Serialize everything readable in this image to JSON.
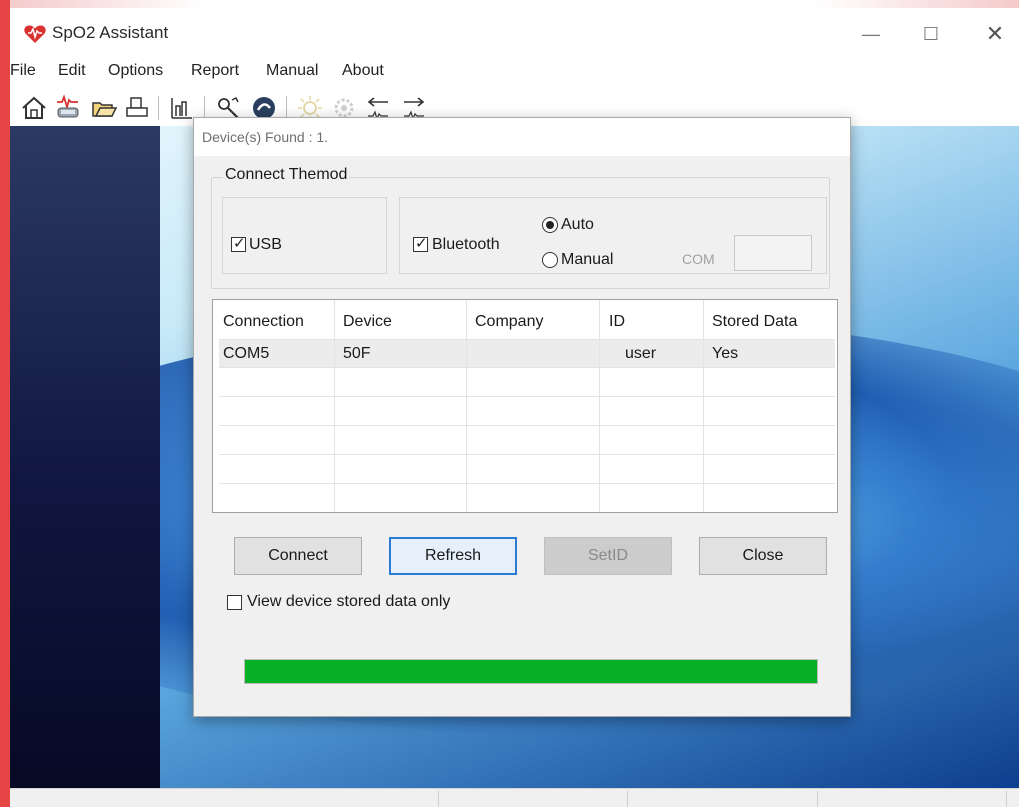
{
  "app": {
    "title": "SpO2 Assistant"
  },
  "window_controls": {
    "minimize": "—",
    "maximize": "☐",
    "close": "✕"
  },
  "menu": [
    "File",
    "Edit",
    "Options",
    "Report",
    "Manual",
    "About"
  ],
  "toolbar": {
    "icons": [
      "home-icon",
      "device-icon",
      "open-folder-icon",
      "print-icon",
      "chart-icon",
      "settings-icon",
      "help-icon",
      "sun-icon",
      "gear-icon",
      "arrow-left-icon",
      "arrow-right-icon"
    ]
  },
  "dialog": {
    "title": "Device(s) Found : 1.",
    "group_label": "Connect Themod",
    "usb": {
      "label": "USB",
      "checked": true
    },
    "bluetooth": {
      "label": "Bluetooth",
      "checked": true
    },
    "mode": {
      "auto_label": "Auto",
      "manual_label": "Manual",
      "selected": "Auto"
    },
    "com_label": "COM",
    "com_value": "",
    "table": {
      "columns": [
        "Connection",
        "Device",
        "Company",
        "ID",
        "Stored Data"
      ],
      "rows": [
        [
          "COM5",
          "50F",
          "",
          "user",
          "Yes"
        ]
      ]
    },
    "buttons": {
      "connect": "Connect",
      "refresh": "Refresh",
      "setid": "SetID",
      "close": "Close"
    },
    "view_only": {
      "label": "View device stored data only",
      "checked": false
    },
    "progress": 1.0
  },
  "colors": {
    "progress": "#06b025",
    "focus": "#2a7bd3",
    "app_icon": "#d93030"
  }
}
